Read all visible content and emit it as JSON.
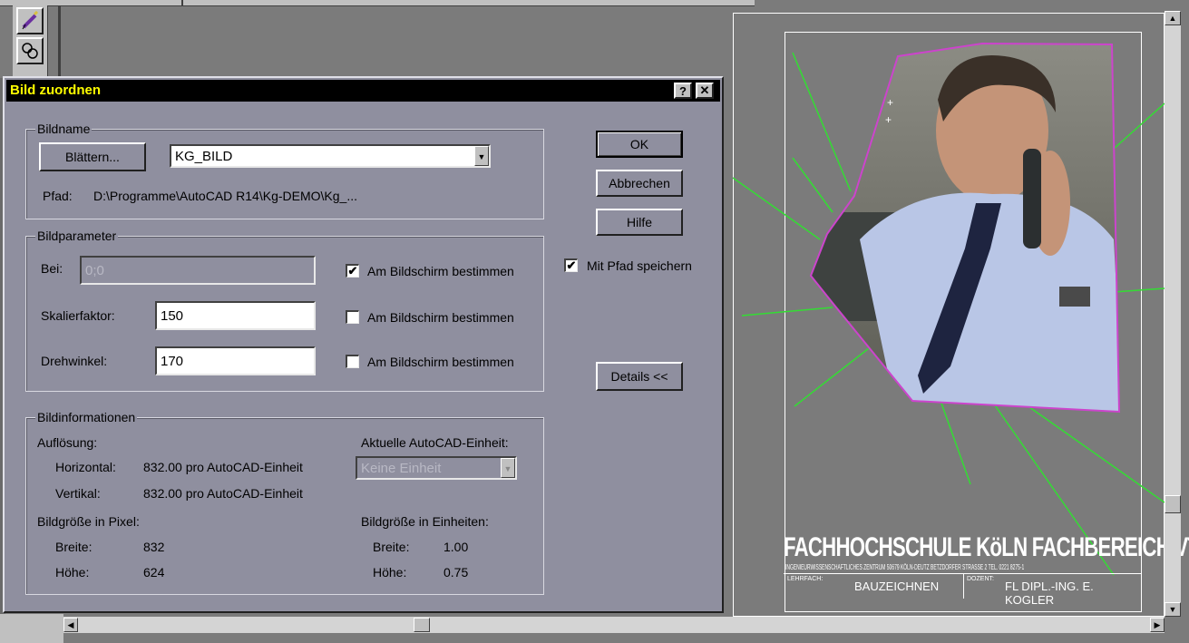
{
  "dialog": {
    "title": "Bild zuordnen",
    "help_btn": "?",
    "close_btn": "✕"
  },
  "bildname": {
    "legend": "Bildname",
    "browse_label": "Blättern...",
    "image_name": "KG_BILD",
    "path_label": "Pfad:",
    "path_value": "D:\\Programme\\AutoCAD R14\\Kg-DEMO\\Kg_..."
  },
  "bildparameter": {
    "legend": "Bildparameter",
    "bei_label": "Bei:",
    "bei_value": "0;0",
    "scale_label": "Skalierfaktor:",
    "scale_value": "150",
    "rotation_label": "Drehwinkel:",
    "rotation_value": "170",
    "onscreen_label": "Am Bildschirm bestimmen",
    "bei_onscreen_checked": "✔",
    "scale_onscreen_checked": "",
    "rotation_onscreen_checked": ""
  },
  "buttons": {
    "ok": "OK",
    "cancel": "Abbrechen",
    "help": "Hilfe",
    "details": "Details <<"
  },
  "save_path": {
    "label": "Mit Pfad speichern",
    "checked": "✔"
  },
  "bildinformationen": {
    "legend": "Bildinformationen",
    "resolution_label": "Auflösung:",
    "horizontal_label": "Horizontal:",
    "horizontal_value": "832.00 pro AutoCAD-Einheit",
    "vertical_label": "Vertikal:",
    "vertical_value": "832.00 pro AutoCAD-Einheit",
    "current_unit_label": "Aktuelle AutoCAD-Einheit:",
    "current_unit_value": "Keine Einheit",
    "pixel_size_label": "Bildgröße in Pixel:",
    "unit_size_label": "Bildgröße in Einheiten:",
    "width_label": "Breite:",
    "height_label": "Höhe:",
    "pixel_width": "832",
    "pixel_height": "624",
    "unit_width": "1.00",
    "unit_height": "0.75"
  },
  "drawing": {
    "school_title": "FACHHOCHSCHULE KöLN FACHBEREICH VT",
    "school_subtitle": "INGENIEURWISSENSCHAFTLICHES ZENTRUM 50679 KÖLN-DEUTZ BETZDORFER STRASSE 2 TEL. 0221 8275-1",
    "subject_label": "LEHRFACH:",
    "subject_value": "BAUZEICHNEN",
    "lecturer_label": "DOZENT:",
    "lecturer_value": "FL DIPL.-ING. E. KOGLER"
  },
  "colors": {
    "titlebar": "#000000",
    "dialog_bg": "#8f8f9f",
    "canvas_bg": "#7b7b7b",
    "leader_lines": "#33dd33",
    "clip_boundary": "#cc44cc"
  }
}
